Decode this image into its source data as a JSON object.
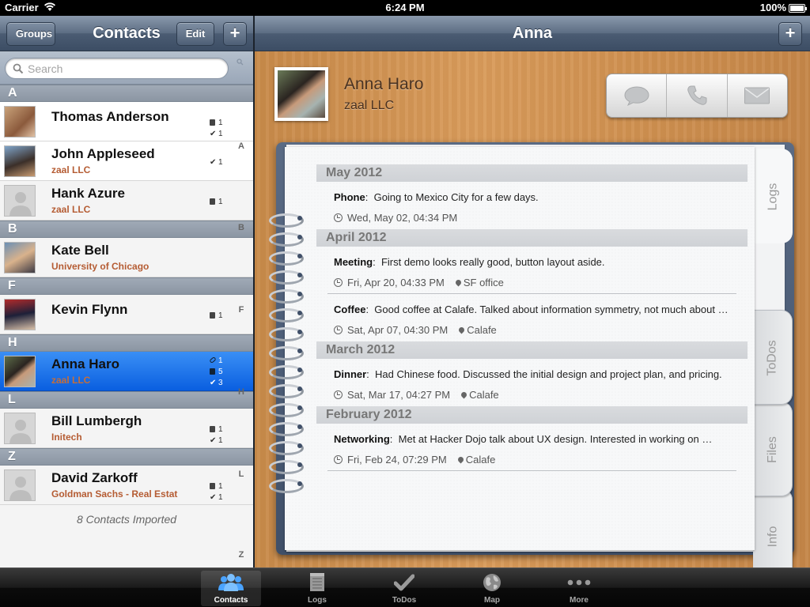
{
  "status_bar": {
    "carrier": "Carrier",
    "time": "6:24 PM",
    "battery": "100%"
  },
  "left": {
    "back_label": "Groups",
    "title": "Contacts",
    "edit_label": "Edit",
    "add_label": "+",
    "search_placeholder": "Search",
    "sections": [
      {
        "letter": "A"
      },
      {
        "letter": "B"
      },
      {
        "letter": "F"
      },
      {
        "letter": "H"
      },
      {
        "letter": "L"
      },
      {
        "letter": "Z"
      }
    ],
    "contacts": [
      {
        "name": "Thomas Anderson",
        "company": "",
        "counts": [
          "1",
          "1"
        ]
      },
      {
        "name": "John Appleseed",
        "company": "zaal LLC",
        "counts": [
          "1"
        ]
      },
      {
        "name": "Hank Azure",
        "company": "zaal LLC",
        "counts": [
          "1"
        ]
      },
      {
        "name": "Kate Bell",
        "company": "University of Chicago",
        "counts": []
      },
      {
        "name": "Kevin Flynn",
        "company": "",
        "counts": [
          "1"
        ]
      },
      {
        "name": "Anna Haro",
        "company": "zaal LLC",
        "counts": [
          "1",
          "5",
          "3"
        ]
      },
      {
        "name": "Bill Lumbergh",
        "company": "Initech",
        "counts": [
          "1",
          "1"
        ]
      },
      {
        "name": "David Zarkoff",
        "company": "Goldman Sachs - Real Estat",
        "counts": [
          "1",
          "1"
        ]
      }
    ],
    "footer_note": "8 Contacts Imported",
    "index_letters": [
      "A",
      "B",
      "F",
      "H",
      "L",
      "Z"
    ]
  },
  "right": {
    "title": "Anna",
    "add_label": "+",
    "contact_name": "Anna Haro",
    "contact_company": "zaal LLC",
    "tabs": [
      "Logs",
      "ToDos",
      "Files",
      "Info"
    ],
    "months": [
      {
        "label": "May 2012",
        "entries": [
          {
            "type": "Phone",
            "text": "Going to Mexico City for a few days.",
            "date": "Wed, May 02, 04:34 PM",
            "place": ""
          }
        ]
      },
      {
        "label": "April 2012",
        "entries": [
          {
            "type": "Meeting",
            "text": "First demo looks really good, button layout aside.",
            "date": "Fri, Apr 20, 04:33 PM",
            "place": "SF office"
          },
          {
            "type": "Coffee",
            "text": "Good coffee at Calafe. Talked about information symmetry, not much about …",
            "date": "Sat, Apr 07, 04:30 PM",
            "place": "Calafe"
          }
        ]
      },
      {
        "label": "March 2012",
        "entries": [
          {
            "type": "Dinner",
            "text": "Had Chinese food. Discussed the initial design and project plan, and pricing.",
            "date": "Sat, Mar 17, 04:27 PM",
            "place": "Calafe"
          }
        ]
      },
      {
        "label": "February 2012",
        "entries": [
          {
            "type": "Networking",
            "text": "Met at Hacker Dojo talk about UX design. Interested in working on …",
            "date": "Fri, Feb 24, 07:29 PM",
            "place": "Calafe"
          }
        ]
      }
    ]
  },
  "tabbar": {
    "items": [
      "Contacts",
      "Logs",
      "ToDos",
      "Map",
      "More"
    ],
    "active": "Contacts"
  }
}
